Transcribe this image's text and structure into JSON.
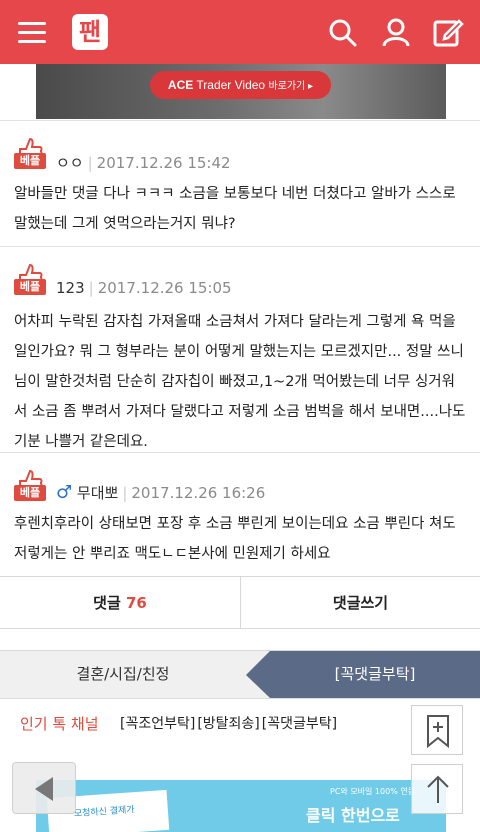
{
  "header": {
    "logo_text": "팬",
    "icons": [
      "menu-icon",
      "search-icon",
      "user-icon",
      "edit-icon"
    ],
    "accent": "#e6474b"
  },
  "banner": {
    "brand": "ACE",
    "title": "Trader Video",
    "cta": "바로가기 ▸"
  },
  "comments": [
    {
      "badge": "베플",
      "author": "ㅇㅇ",
      "date": "2017.12.26 15:42",
      "body": "알바들만 댓글 다나 ㅋㅋㅋ 소금을 보통보다 네번 더쳤다고 알바가 스스로 말했는데 그게 엿먹으라는거지 뭐냐?"
    },
    {
      "badge": "베플",
      "author": "123",
      "date": "2017.12.26 15:05",
      "body": "어차피 누락된 감자칩 가져올때 소금쳐서 가져다 달라는게 그렇게 욕 먹을 일인가요? 뭐 그 형부라는 분이 어떻게 말했는지는 모르겠지만... 정말 쓰니님이 말한것처럼 단순히 감자칩이 빠졌고,1~2개 먹어봤는데 너무 싱거워서 소금 좀 뿌려서 가져다 달랬다고 저렇게 소금 범벅을 해서 보내면....나도 기분 나쁠거 같은데요."
    },
    {
      "badge": "베플",
      "author_icon": "♂",
      "author": "무대뽀",
      "date": "2017.12.26 16:26",
      "body": "후렌치후라이 상태보면 포장 후 소금 뿌린게 보이는데요 소금 뿌린다 쳐도 저렇게는 안 뿌리죠 맥도ㄴㄷ본사에 민원제기 하세요"
    }
  ],
  "actions": {
    "comments_label": "댓글",
    "comments_count": "76",
    "write_label": "댓글쓰기"
  },
  "category_tabs": {
    "left": "결혼/시집/친정",
    "right": "[꼭댓글부탁]"
  },
  "channel": {
    "label": "인기 톡 채널",
    "links": [
      "[꼭조언부탁]",
      "[방탈죄송]",
      "[꼭댓글부탁]"
    ]
  },
  "bottom_ad": {
    "small": "PC와 모바일 100% 연동",
    "headline": "클릭 한번으로",
    "paper_text": "모청하신 결제가"
  }
}
